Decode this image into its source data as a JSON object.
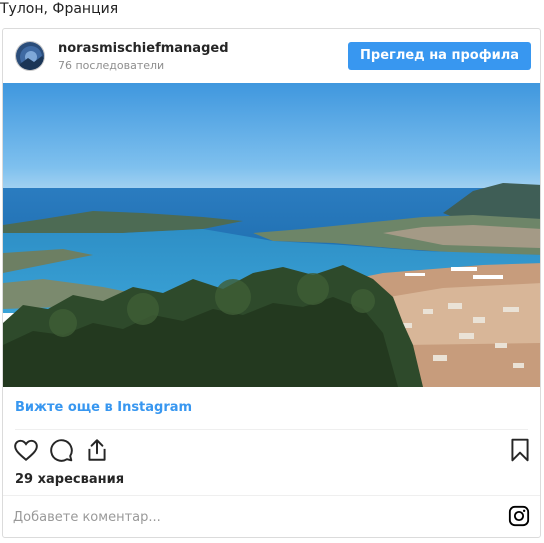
{
  "location_title": "Тулон, Франция",
  "post": {
    "username": "norasmischiefmanaged",
    "followers": "76 последователи",
    "view_profile_label": "Преглед на профила",
    "view_more_label": "Вижте още в Instagram",
    "likes": "29 харесвания",
    "comment_placeholder": "Добавете коментар..."
  },
  "icons": {
    "like": "heart-icon",
    "comment": "comment-icon",
    "share": "share-icon",
    "save": "bookmark-icon",
    "brand": "instagram-icon"
  },
  "colors": {
    "accent": "#3897f0",
    "border": "#dbdbdb",
    "muted": "#8e8e8e"
  }
}
